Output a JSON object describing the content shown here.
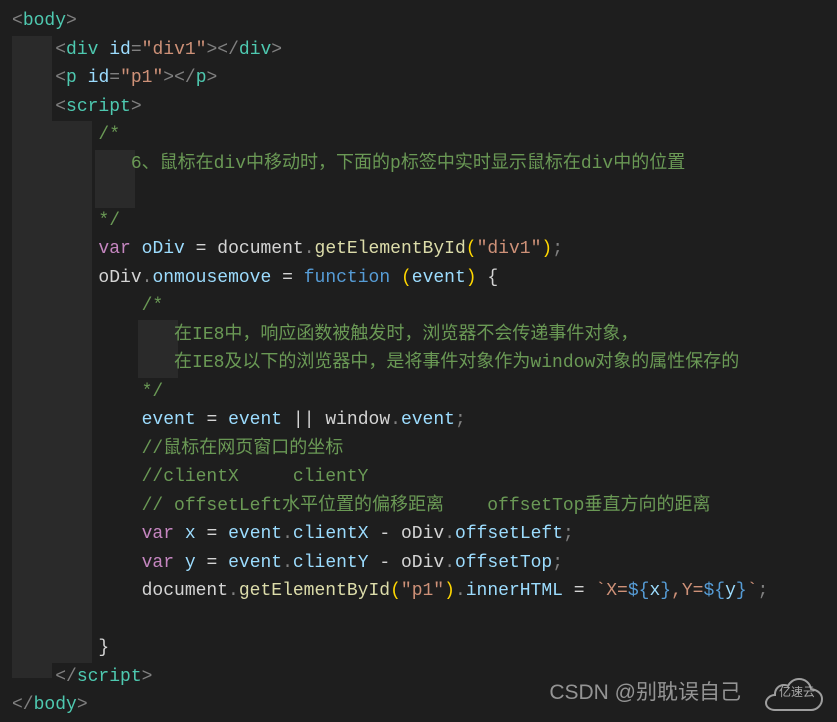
{
  "code": {
    "l1": {
      "tag": "body"
    },
    "l2": {
      "tag": "div",
      "attr": "id",
      "val": "\"div1\""
    },
    "l3": {
      "tag": "p",
      "attr": "id",
      "val": "\"p1\""
    },
    "l4": {
      "tag": "script"
    },
    "l5": "/*",
    "l6": "   6、鼠标在div中移动时，下面的p标签中实时显示鼠标在div中的位置",
    "l7": "",
    "l8": "*/",
    "l9": {
      "kw": "var",
      "v": "oDiv",
      "obj": "document",
      "fn": "getElementById",
      "arg": "\"div1\""
    },
    "l10": {
      "lhs_obj": "oDiv",
      "lhs_prop": "onmousemove",
      "kw": "function",
      "param": "event"
    },
    "l11": "/*",
    "l12": "   在IE8中，响应函数被触发时，浏览器不会传递事件对象，",
    "l13": "   在IE8及以下的浏览器中，是将事件对象作为window对象的属性保存的",
    "l14": "*/",
    "l15": {
      "lhs": "event",
      "rhs1": "event",
      "rhs2_obj": "window",
      "rhs2_prop": "event"
    },
    "l16": "//鼠标在网页窗口的坐标",
    "l17": "//clientX     clientY",
    "l18": "// offsetLeft水平位置的偏移距离    offsetTop垂直方向的距离",
    "l19": {
      "kw": "var",
      "v": "x",
      "a_obj": "event",
      "a_prop": "clientX",
      "b_obj": "oDiv",
      "b_prop": "offsetLeft"
    },
    "l20": {
      "kw": "var",
      "v": "y",
      "a_obj": "event",
      "a_prop": "clientY",
      "b_obj": "oDiv",
      "b_prop": "offsetTop"
    },
    "l21": {
      "obj": "document",
      "fn": "getElementById",
      "arg": "\"p1\"",
      "prop": "innerHTML",
      "t1": "X=",
      "v1": "x",
      "t2": ",Y=",
      "v2": "y"
    },
    "l22": "",
    "l23": "}",
    "l24": {
      "closetag": "script"
    },
    "l25": {
      "closetag": "body"
    }
  },
  "watermark": "CSDN @别耽误自己",
  "cloud_label": "亿速云"
}
